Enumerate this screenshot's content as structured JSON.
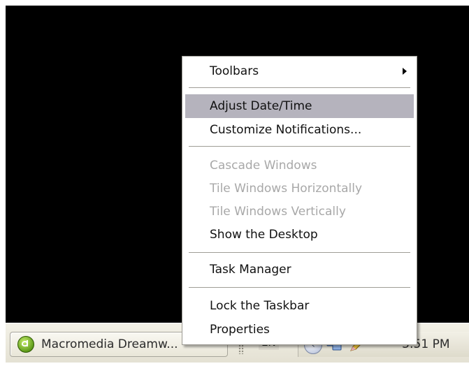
{
  "menu": {
    "items": [
      {
        "label": "Toolbars",
        "has_submenu": true,
        "enabled": true
      },
      {
        "label": "Adjust Date/Time",
        "enabled": true,
        "highlighted": true
      },
      {
        "label": "Customize Notifications...",
        "enabled": true
      },
      {
        "label": "Cascade Windows",
        "enabled": false
      },
      {
        "label": "Tile Windows Horizontally",
        "enabled": false
      },
      {
        "label": "Tile Windows Vertically",
        "enabled": false
      },
      {
        "label": "Show the Desktop",
        "enabled": true
      },
      {
        "label": "Task Manager",
        "enabled": true
      },
      {
        "label": "Lock the Taskbar",
        "enabled": true
      },
      {
        "label": "Properties",
        "enabled": true
      }
    ]
  },
  "taskbar": {
    "task_button_label": "Macromedia Dreamw...",
    "language": "EN",
    "clock": "3:51 PM"
  },
  "colors": {
    "desktop": "#000000",
    "menu_highlight": "#b5b3bd",
    "disabled_text": "#a8a8a8"
  },
  "icons": {
    "app": "dreamweaver-icon",
    "tray": [
      "tray-expand-chevron-icon",
      "network-icon",
      "pencil-icon"
    ]
  }
}
